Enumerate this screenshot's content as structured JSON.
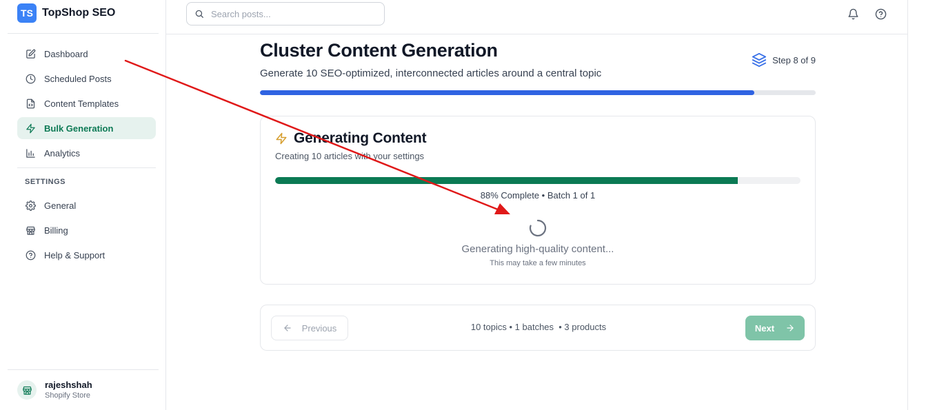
{
  "brand": {
    "logo_text": "TS",
    "name": "TopShop SEO",
    "color": "#3b82f6"
  },
  "sidebar": {
    "items": [
      {
        "label": "Dashboard",
        "icon": "edit-icon"
      },
      {
        "label": "Scheduled Posts",
        "icon": "clock-icon"
      },
      {
        "label": "Content Templates",
        "icon": "file-code-icon"
      },
      {
        "label": "Bulk Generation",
        "icon": "lightning-icon",
        "active": true
      },
      {
        "label": "Analytics",
        "icon": "bar-chart-icon"
      }
    ],
    "settings_heading": "SETTINGS",
    "settings_items": [
      {
        "label": "General",
        "icon": "gear-icon"
      },
      {
        "label": "Billing",
        "icon": "store-icon"
      },
      {
        "label": "Help & Support",
        "icon": "help-circle-icon"
      }
    ],
    "user": {
      "name": "rajeshshah",
      "subtitle": "Shopify Store"
    }
  },
  "topbar": {
    "search_placeholder": "Search posts..."
  },
  "main": {
    "title": "Cluster Content Generation",
    "subtitle": "Generate 10 SEO-optimized, interconnected articles around a central topic",
    "step_text": "Step 8 of 9",
    "step_progress": 0.889,
    "card": {
      "title": "Generating Content",
      "subtitle": "Creating 10 articles with your settings",
      "progress": 0.88,
      "progress_text": "88% Complete • Batch 1 of 1",
      "status": "Generating high-quality content...",
      "note": "This may take a few minutes"
    },
    "footer": {
      "prev_label": "Previous",
      "info": "10 topics • 1 batches  • 3 products",
      "next_label": "Next"
    }
  },
  "colors": {
    "accent_green": "#0b7a54",
    "accent_blue": "#2f63e2",
    "annotation_red": "#e01919"
  }
}
